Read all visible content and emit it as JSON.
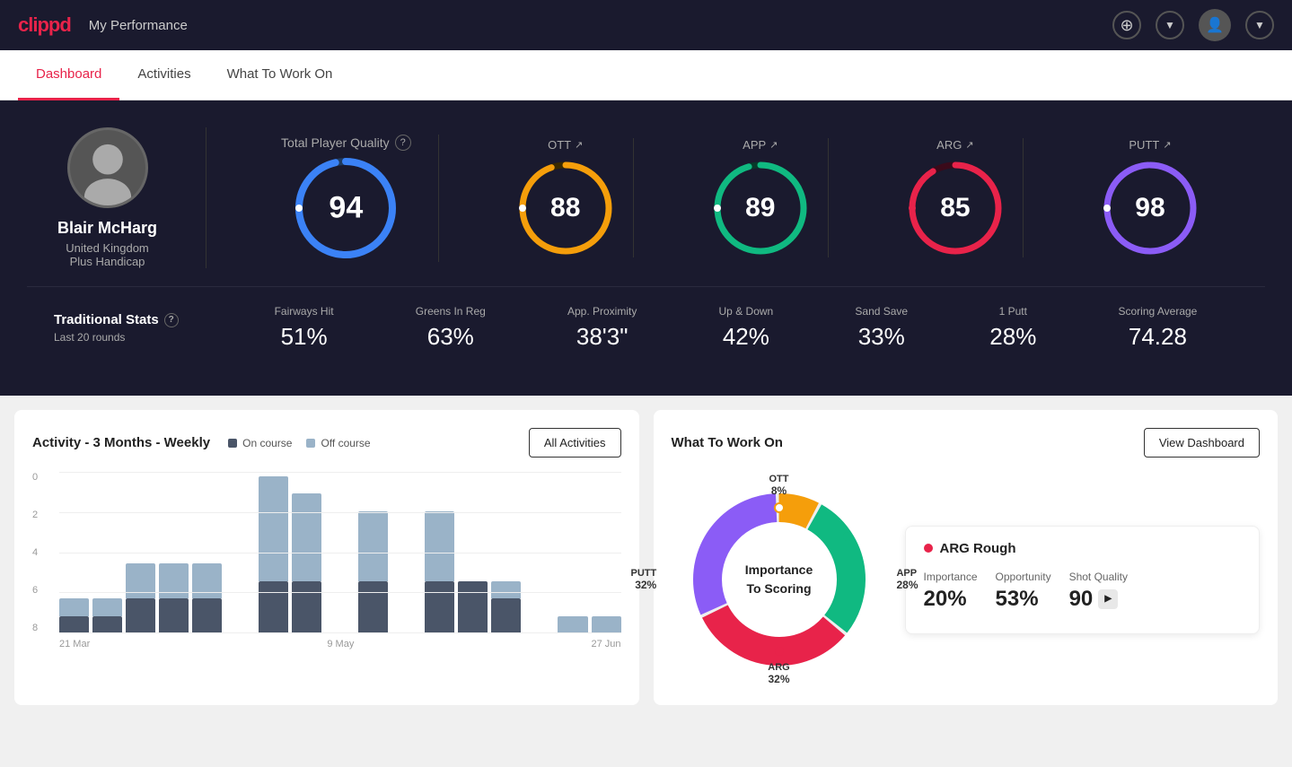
{
  "app": {
    "logo": "clippd",
    "nav_title": "My Performance"
  },
  "tabs": [
    {
      "id": "dashboard",
      "label": "Dashboard",
      "active": true
    },
    {
      "id": "activities",
      "label": "Activities",
      "active": false
    },
    {
      "id": "what_to_work_on",
      "label": "What To Work On",
      "active": false
    }
  ],
  "player": {
    "name": "Blair McHarg",
    "country": "United Kingdom",
    "handicap": "Plus Handicap"
  },
  "scores": {
    "total": {
      "label": "Total Player Quality",
      "value": 94,
      "color": "#3b82f6",
      "track_color": "#1e3a5f"
    },
    "categories": [
      {
        "id": "ott",
        "label": "OTT",
        "value": 88,
        "color": "#f59e0b",
        "track_color": "#3a2a00",
        "trend": "up"
      },
      {
        "id": "app",
        "label": "APP",
        "value": 89,
        "color": "#10b981",
        "track_color": "#063a2a",
        "trend": "up"
      },
      {
        "id": "arg",
        "label": "ARG",
        "value": 85,
        "color": "#e8234a",
        "track_color": "#3a0a1a",
        "trend": "up"
      },
      {
        "id": "putt",
        "label": "PUTT",
        "value": 98,
        "color": "#8b5cf6",
        "track_color": "#2a1a4a",
        "trend": "up"
      }
    ]
  },
  "traditional_stats": {
    "title": "Traditional Stats",
    "subtitle": "Last 20 rounds",
    "items": [
      {
        "label": "Fairways Hit",
        "value": "51%"
      },
      {
        "label": "Greens In Reg",
        "value": "63%"
      },
      {
        "label": "App. Proximity",
        "value": "38'3\""
      },
      {
        "label": "Up & Down",
        "value": "42%"
      },
      {
        "label": "Sand Save",
        "value": "33%"
      },
      {
        "label": "1 Putt",
        "value": "28%"
      },
      {
        "label": "Scoring Average",
        "value": "74.28"
      }
    ]
  },
  "activity_chart": {
    "title": "Activity - 3 Months - Weekly",
    "legend": [
      {
        "label": "On course",
        "color": "#4a5568"
      },
      {
        "label": "Off course",
        "color": "#9ab3c8"
      }
    ],
    "all_activities_btn": "All Activities",
    "y_axis": [
      "0",
      "2",
      "4",
      "6",
      "8"
    ],
    "x_axis": [
      "21 Mar",
      "9 May",
      "27 Jun"
    ],
    "bars": [
      {
        "on": 1,
        "off": 1
      },
      {
        "on": 1,
        "off": 1
      },
      {
        "on": 2,
        "off": 2
      },
      {
        "on": 2,
        "off": 2
      },
      {
        "on": 2,
        "off": 2
      },
      {
        "on": 0,
        "off": 0
      },
      {
        "on": 3,
        "off": 6
      },
      {
        "on": 3,
        "off": 5
      },
      {
        "on": 0,
        "off": 0
      },
      {
        "on": 3,
        "off": 4
      },
      {
        "on": 0,
        "off": 0
      },
      {
        "on": 3,
        "off": 4
      },
      {
        "on": 3,
        "off": 0
      },
      {
        "on": 2,
        "off": 1
      },
      {
        "on": 0,
        "off": 0
      },
      {
        "on": 0,
        "off": 1
      },
      {
        "on": 0,
        "off": 1
      }
    ]
  },
  "what_to_work_on": {
    "title": "What To Work On",
    "view_dashboard_btn": "View Dashboard",
    "donut_center": "Importance\nTo Scoring",
    "segments": [
      {
        "label": "OTT",
        "value": "8%",
        "color": "#f59e0b",
        "percent": 8
      },
      {
        "label": "APP",
        "value": "28%",
        "color": "#10b981",
        "percent": 28
      },
      {
        "label": "ARG",
        "value": "32%",
        "color": "#e8234a",
        "percent": 32
      },
      {
        "label": "PUTT",
        "value": "32%",
        "color": "#8b5cf6",
        "percent": 32
      }
    ],
    "highlight_card": {
      "title": "ARG Rough",
      "dot_color": "#e8234a",
      "metrics": [
        {
          "label": "Importance",
          "value": "20%"
        },
        {
          "label": "Opportunity",
          "value": "53%"
        },
        {
          "label": "Shot Quality",
          "value": "90"
        }
      ]
    }
  }
}
